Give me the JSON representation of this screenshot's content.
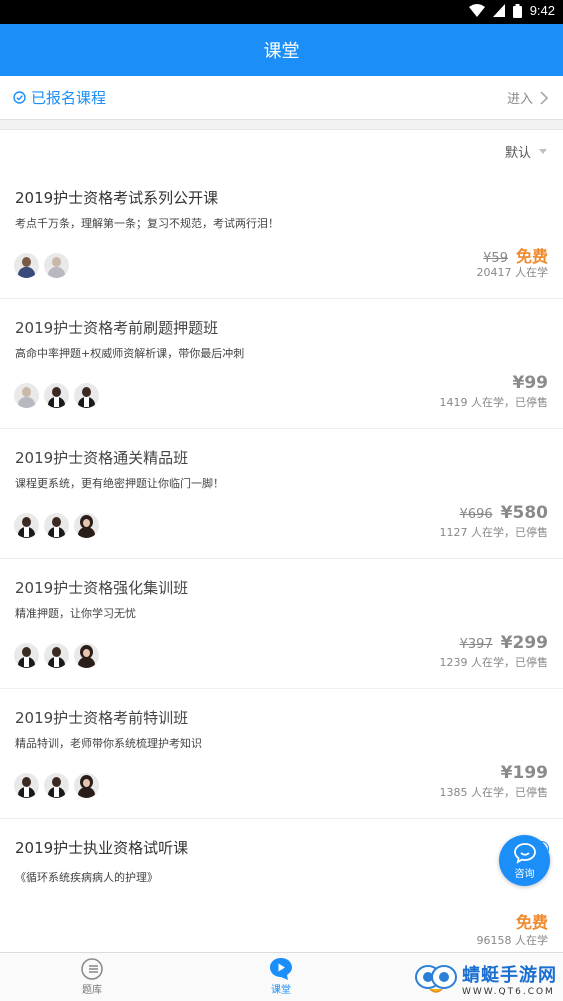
{
  "status_bar": {
    "time": "9:42",
    "icons": [
      "wifi-icon",
      "signal-icon",
      "battery-icon"
    ]
  },
  "header": {
    "title": "课堂"
  },
  "enrolled": {
    "label": "已报名课程",
    "action": "进入"
  },
  "sort": {
    "label": "默认"
  },
  "courses": [
    {
      "title": "2019护士资格考试系列公开课",
      "desc": "考点千万条，理解第一条；复习不规范，考试两行泪！",
      "original_price": "¥59",
      "price": "免费",
      "sub": "20417 人在学"
    },
    {
      "title": "2019护士资格考前刷题押题班",
      "desc": "高命中率押题+权威师资解析课，带你最后冲刺",
      "original_price": "",
      "price": "¥99",
      "sub": "1419 人在学，已停售"
    },
    {
      "title": "2019护士资格通关精品班",
      "desc": "课程更系统，更有绝密押题让你临门一脚！",
      "original_price": "¥696",
      "price": "¥580",
      "sub": "1127 人在学，已停售"
    },
    {
      "title": "2019护士资格强化集训班",
      "desc": "精准押题，让你学习无忧",
      "original_price": "¥397",
      "price": "¥299",
      "sub": "1239 人在学，已停售"
    },
    {
      "title": "2019护士资格考前特训班",
      "desc": "精品特训，老师带你系统梳理护考知识",
      "original_price": "",
      "price": "¥199",
      "sub": "1385 人在学，已停售"
    },
    {
      "title": "2019护士执业资格试听课",
      "desc": "《循环系统疾病病人的护理》",
      "tag": "免费",
      "price": "免费",
      "sub": "96158 人在学"
    }
  ],
  "float_button": {
    "label": "咨询"
  },
  "tabs": [
    {
      "label": "题库"
    },
    {
      "label": "课堂"
    }
  ],
  "watermark": {
    "main": "蜻蜓手游网",
    "sub": "WWW.QT6.COM"
  },
  "colors": {
    "primary": "#1b8ff7",
    "price_free": "#f08a2c"
  }
}
